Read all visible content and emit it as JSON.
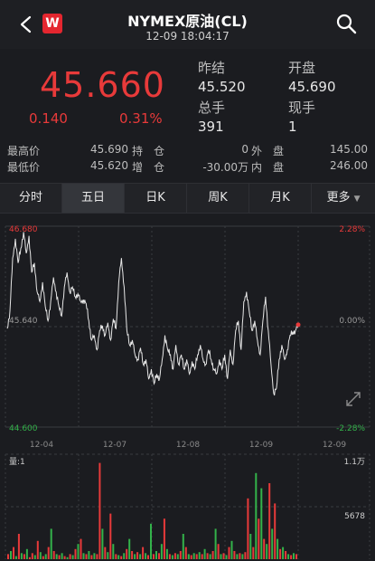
{
  "header": {
    "title": "NYMEX原油(CL)",
    "subtitle": "12-09 18:04:17",
    "logo_letter": "W"
  },
  "quote": {
    "price": "45.660",
    "change": "0.140",
    "change_pct": "0.31%",
    "prev_close_label": "昨结",
    "prev_close": "45.520",
    "open_label": "开盘",
    "open": "45.690",
    "total_volume_label": "总手",
    "total_volume": "391",
    "current_volume_label": "现手",
    "current_volume": "1"
  },
  "stats": {
    "high_label": "最高价",
    "high": "45.690",
    "low_label": "最低价",
    "low": "45.620",
    "hold_label": "持　仓",
    "hold": "0",
    "increase_label": "增　仓",
    "increase": "-30.00万",
    "outer_label": "外　盘",
    "outer": "145.00",
    "inner_label": "内　盘",
    "inner": "246.00"
  },
  "tabs": [
    "分时",
    "五日",
    "日K",
    "周K",
    "月K",
    "更多"
  ],
  "active_tab": 1,
  "colors": {
    "up": "#e83a3a",
    "down": "#33b24a",
    "line": "#e6e6e6",
    "background": "#1b1c20"
  },
  "chart_data": {
    "type": "line",
    "price_labels": {
      "top": "46.680",
      "mid": "45.640",
      "bottom": "44.600"
    },
    "pct_labels": {
      "top": "2.28%",
      "mid": "0.00%",
      "bottom": "-2.28%"
    },
    "x_ticks": [
      "12-04",
      "12-07",
      "12-08",
      "12-09",
      "12-09"
    ],
    "ylim": [
      44.6,
      46.68
    ],
    "series": [
      {
        "values": [
          45.62,
          45.8,
          46.35,
          46.55,
          46.3,
          46.45,
          46.62,
          46.4,
          46.58,
          46.2,
          46.3,
          46.0,
          45.9,
          46.1,
          45.85,
          45.7,
          45.9,
          46.15,
          46.0,
          45.85,
          45.75,
          46.05,
          46.2,
          46.0,
          46.05,
          45.95,
          45.98,
          45.9,
          45.92,
          45.88,
          45.7,
          45.5,
          45.55,
          45.4,
          45.6,
          45.65,
          45.55,
          45.68,
          45.5,
          45.72,
          45.62,
          46.1,
          46.35,
          46.05,
          45.6,
          45.45,
          45.5,
          45.35,
          45.3,
          45.42,
          45.25,
          45.3,
          45.1,
          45.2,
          45.05,
          45.15,
          45.1,
          45.3,
          45.55,
          45.4,
          45.35,
          45.2,
          45.45,
          45.25,
          45.35,
          45.2,
          45.3,
          45.15,
          45.28,
          45.2,
          45.35,
          45.45,
          45.3,
          45.25,
          45.4,
          45.3,
          45.2,
          45.15,
          45.3,
          45.2,
          45.35,
          45.1,
          45.4,
          45.25,
          45.6,
          45.7,
          45.4,
          45.9,
          46.0,
          45.8,
          45.6,
          45.7,
          45.5,
          45.35,
          45.7,
          45.95,
          45.6,
          45.25,
          44.95,
          45.0,
          45.3,
          45.45,
          45.3,
          45.4,
          45.55,
          45.58,
          45.6,
          45.66
        ]
      }
    ],
    "volume": {
      "label": "量:1",
      "max_label": "1.1万",
      "mid_label": "5678",
      "max": 11000,
      "bars": [
        [
          0.05,
          "u"
        ],
        [
          0.08,
          "d"
        ],
        [
          0.12,
          "u"
        ],
        [
          0.03,
          "d"
        ],
        [
          0.25,
          "u"
        ],
        [
          0.06,
          "d"
        ],
        [
          0.05,
          "u"
        ],
        [
          0.1,
          "d"
        ],
        [
          0.02,
          "u"
        ],
        [
          0.06,
          "u"
        ],
        [
          0.04,
          "d"
        ],
        [
          0.18,
          "u"
        ],
        [
          0.07,
          "d"
        ],
        [
          0.03,
          "u"
        ],
        [
          0.05,
          "d"
        ],
        [
          0.12,
          "u"
        ],
        [
          0.3,
          "d"
        ],
        [
          0.08,
          "u"
        ],
        [
          0.05,
          "d"
        ],
        [
          0.04,
          "u"
        ],
        [
          0.06,
          "d"
        ],
        [
          0.03,
          "u"
        ],
        [
          0.02,
          "d"
        ],
        [
          0.05,
          "u"
        ],
        [
          0.04,
          "d"
        ],
        [
          0.1,
          "u"
        ],
        [
          0.15,
          "d"
        ],
        [
          0.2,
          "u"
        ],
        [
          0.06,
          "d"
        ],
        [
          0.05,
          "u"
        ],
        [
          0.08,
          "d"
        ],
        [
          0.04,
          "u"
        ],
        [
          0.06,
          "d"
        ],
        [
          0.05,
          "u"
        ],
        [
          0.95,
          "u"
        ],
        [
          0.3,
          "d"
        ],
        [
          0.12,
          "u"
        ],
        [
          0.07,
          "d"
        ],
        [
          0.45,
          "u"
        ],
        [
          0.15,
          "d"
        ],
        [
          0.05,
          "u"
        ],
        [
          0.04,
          "d"
        ],
        [
          0.03,
          "u"
        ],
        [
          0.06,
          "d"
        ],
        [
          0.1,
          "u"
        ],
        [
          0.2,
          "d"
        ],
        [
          0.08,
          "u"
        ],
        [
          0.05,
          "d"
        ],
        [
          0.07,
          "u"
        ],
        [
          0.05,
          "d"
        ],
        [
          0.12,
          "u"
        ],
        [
          0.06,
          "d"
        ],
        [
          0.04,
          "u"
        ],
        [
          0.35,
          "d"
        ],
        [
          0.05,
          "u"
        ],
        [
          0.08,
          "d"
        ],
        [
          0.06,
          "u"
        ],
        [
          0.15,
          "d"
        ],
        [
          0.4,
          "u"
        ],
        [
          0.1,
          "d"
        ],
        [
          0.05,
          "u"
        ],
        [
          0.04,
          "d"
        ],
        [
          0.06,
          "u"
        ],
        [
          0.05,
          "d"
        ],
        [
          0.08,
          "u"
        ],
        [
          0.25,
          "d"
        ],
        [
          0.12,
          "u"
        ],
        [
          0.05,
          "d"
        ],
        [
          0.04,
          "u"
        ],
        [
          0.06,
          "d"
        ],
        [
          0.05,
          "u"
        ],
        [
          0.07,
          "d"
        ],
        [
          0.05,
          "u"
        ],
        [
          0.1,
          "d"
        ],
        [
          0.06,
          "u"
        ],
        [
          0.05,
          "d"
        ],
        [
          0.08,
          "u"
        ],
        [
          0.3,
          "d"
        ],
        [
          0.15,
          "u"
        ],
        [
          0.05,
          "d"
        ],
        [
          0.06,
          "u"
        ],
        [
          0.04,
          "d"
        ],
        [
          0.12,
          "u"
        ],
        [
          0.18,
          "d"
        ],
        [
          0.08,
          "u"
        ],
        [
          0.05,
          "d"
        ],
        [
          0.06,
          "u"
        ],
        [
          0.05,
          "d"
        ],
        [
          0.07,
          "u"
        ],
        [
          0.6,
          "u"
        ],
        [
          0.25,
          "d"
        ],
        [
          0.12,
          "u"
        ],
        [
          0.85,
          "d"
        ],
        [
          0.4,
          "u"
        ],
        [
          0.7,
          "d"
        ],
        [
          0.2,
          "u"
        ],
        [
          0.15,
          "d"
        ],
        [
          0.75,
          "u"
        ],
        [
          0.3,
          "d"
        ],
        [
          0.55,
          "u"
        ],
        [
          0.2,
          "d"
        ],
        [
          0.1,
          "u"
        ],
        [
          0.12,
          "d"
        ],
        [
          0.08,
          "u"
        ],
        [
          0.05,
          "d"
        ],
        [
          0.04,
          "u"
        ],
        [
          0.06,
          "d"
        ],
        [
          0.05,
          "u"
        ]
      ]
    }
  }
}
